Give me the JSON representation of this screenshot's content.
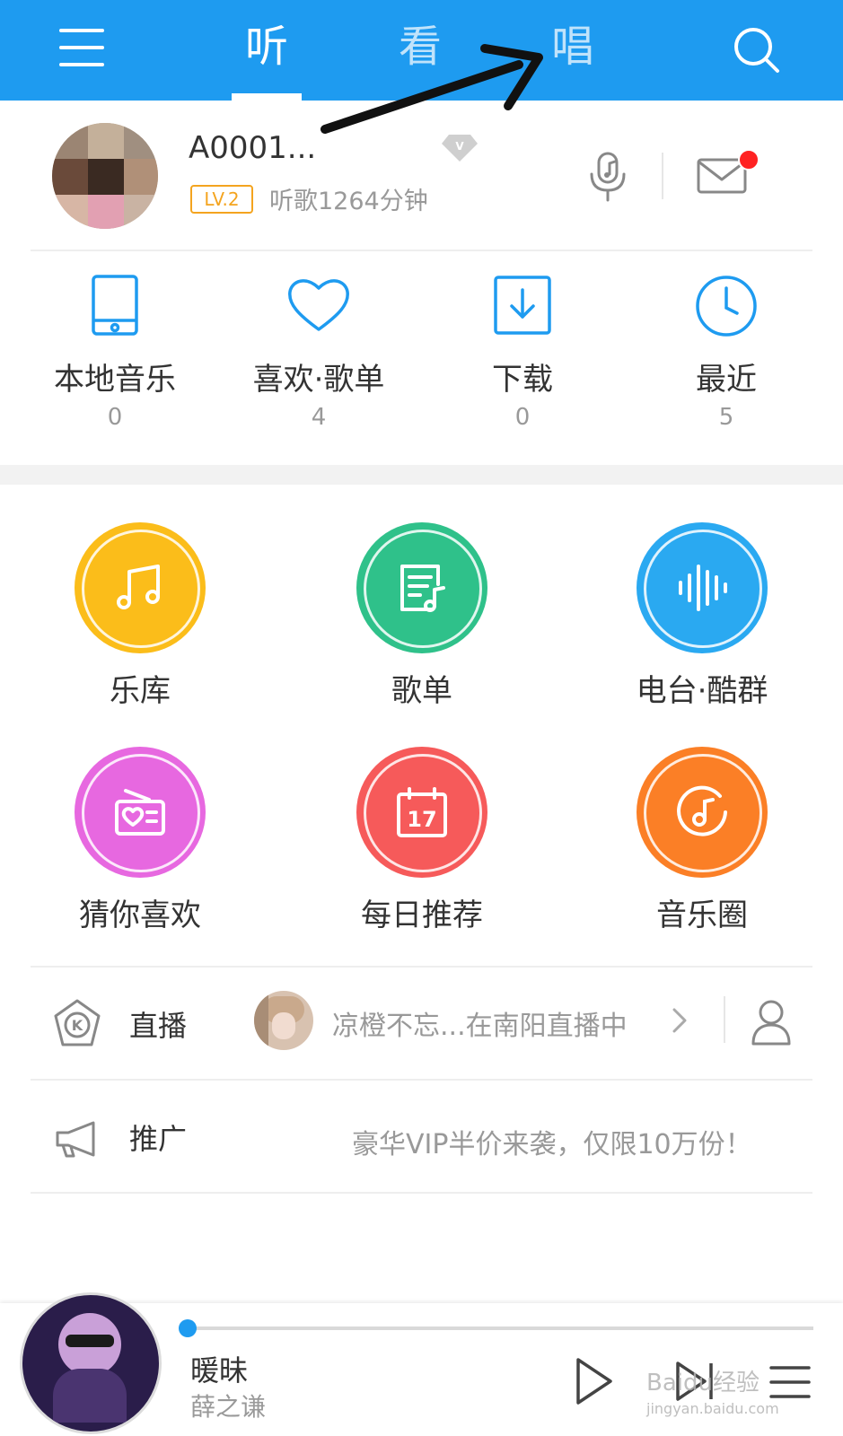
{
  "header": {
    "tabs": [
      {
        "label": "听",
        "active": true
      },
      {
        "label": "看",
        "active": false
      },
      {
        "label": "唱",
        "active": false
      }
    ],
    "bg_color": "#1e9bf0"
  },
  "profile": {
    "username": "A0001...",
    "level": "LV.2",
    "listen_time": "听歌1264分钟"
  },
  "quick": [
    {
      "label": "本地音乐",
      "count": "0",
      "icon": "tablet-icon"
    },
    {
      "label": "喜欢·歌单",
      "count": "4",
      "icon": "heart-icon"
    },
    {
      "label": "下载",
      "count": "0",
      "icon": "download-icon"
    },
    {
      "label": "最近",
      "count": "5",
      "icon": "clock-icon"
    }
  ],
  "features": [
    {
      "label": "乐库",
      "color": "#fbbd1a",
      "icon": "music-note-icon"
    },
    {
      "label": "歌单",
      "color": "#2fc18a",
      "icon": "playlist-icon"
    },
    {
      "label": "电台·酷群",
      "color": "#2aa9f1",
      "icon": "waveform-icon"
    },
    {
      "label": "猜你喜欢",
      "color": "#e768e0",
      "icon": "radio-icon"
    },
    {
      "label": "每日推荐",
      "color": "#f65a5a",
      "icon": "calendar-icon",
      "calendar_day": "17"
    },
    {
      "label": "音乐圈",
      "color": "#fb7f26",
      "icon": "music-circle-icon"
    }
  ],
  "live": {
    "label": "直播",
    "text": "凉橙不忘...在南阳直播中"
  },
  "promo": {
    "label": "推广",
    "text": "豪华VIP半价来袭，仅限10万份！"
  },
  "player": {
    "song": "暖昧",
    "artist": "薛之谦",
    "progress": 0.01
  },
  "watermark": {
    "text": "Baidu经验",
    "url": "jingyan.baidu.com"
  }
}
